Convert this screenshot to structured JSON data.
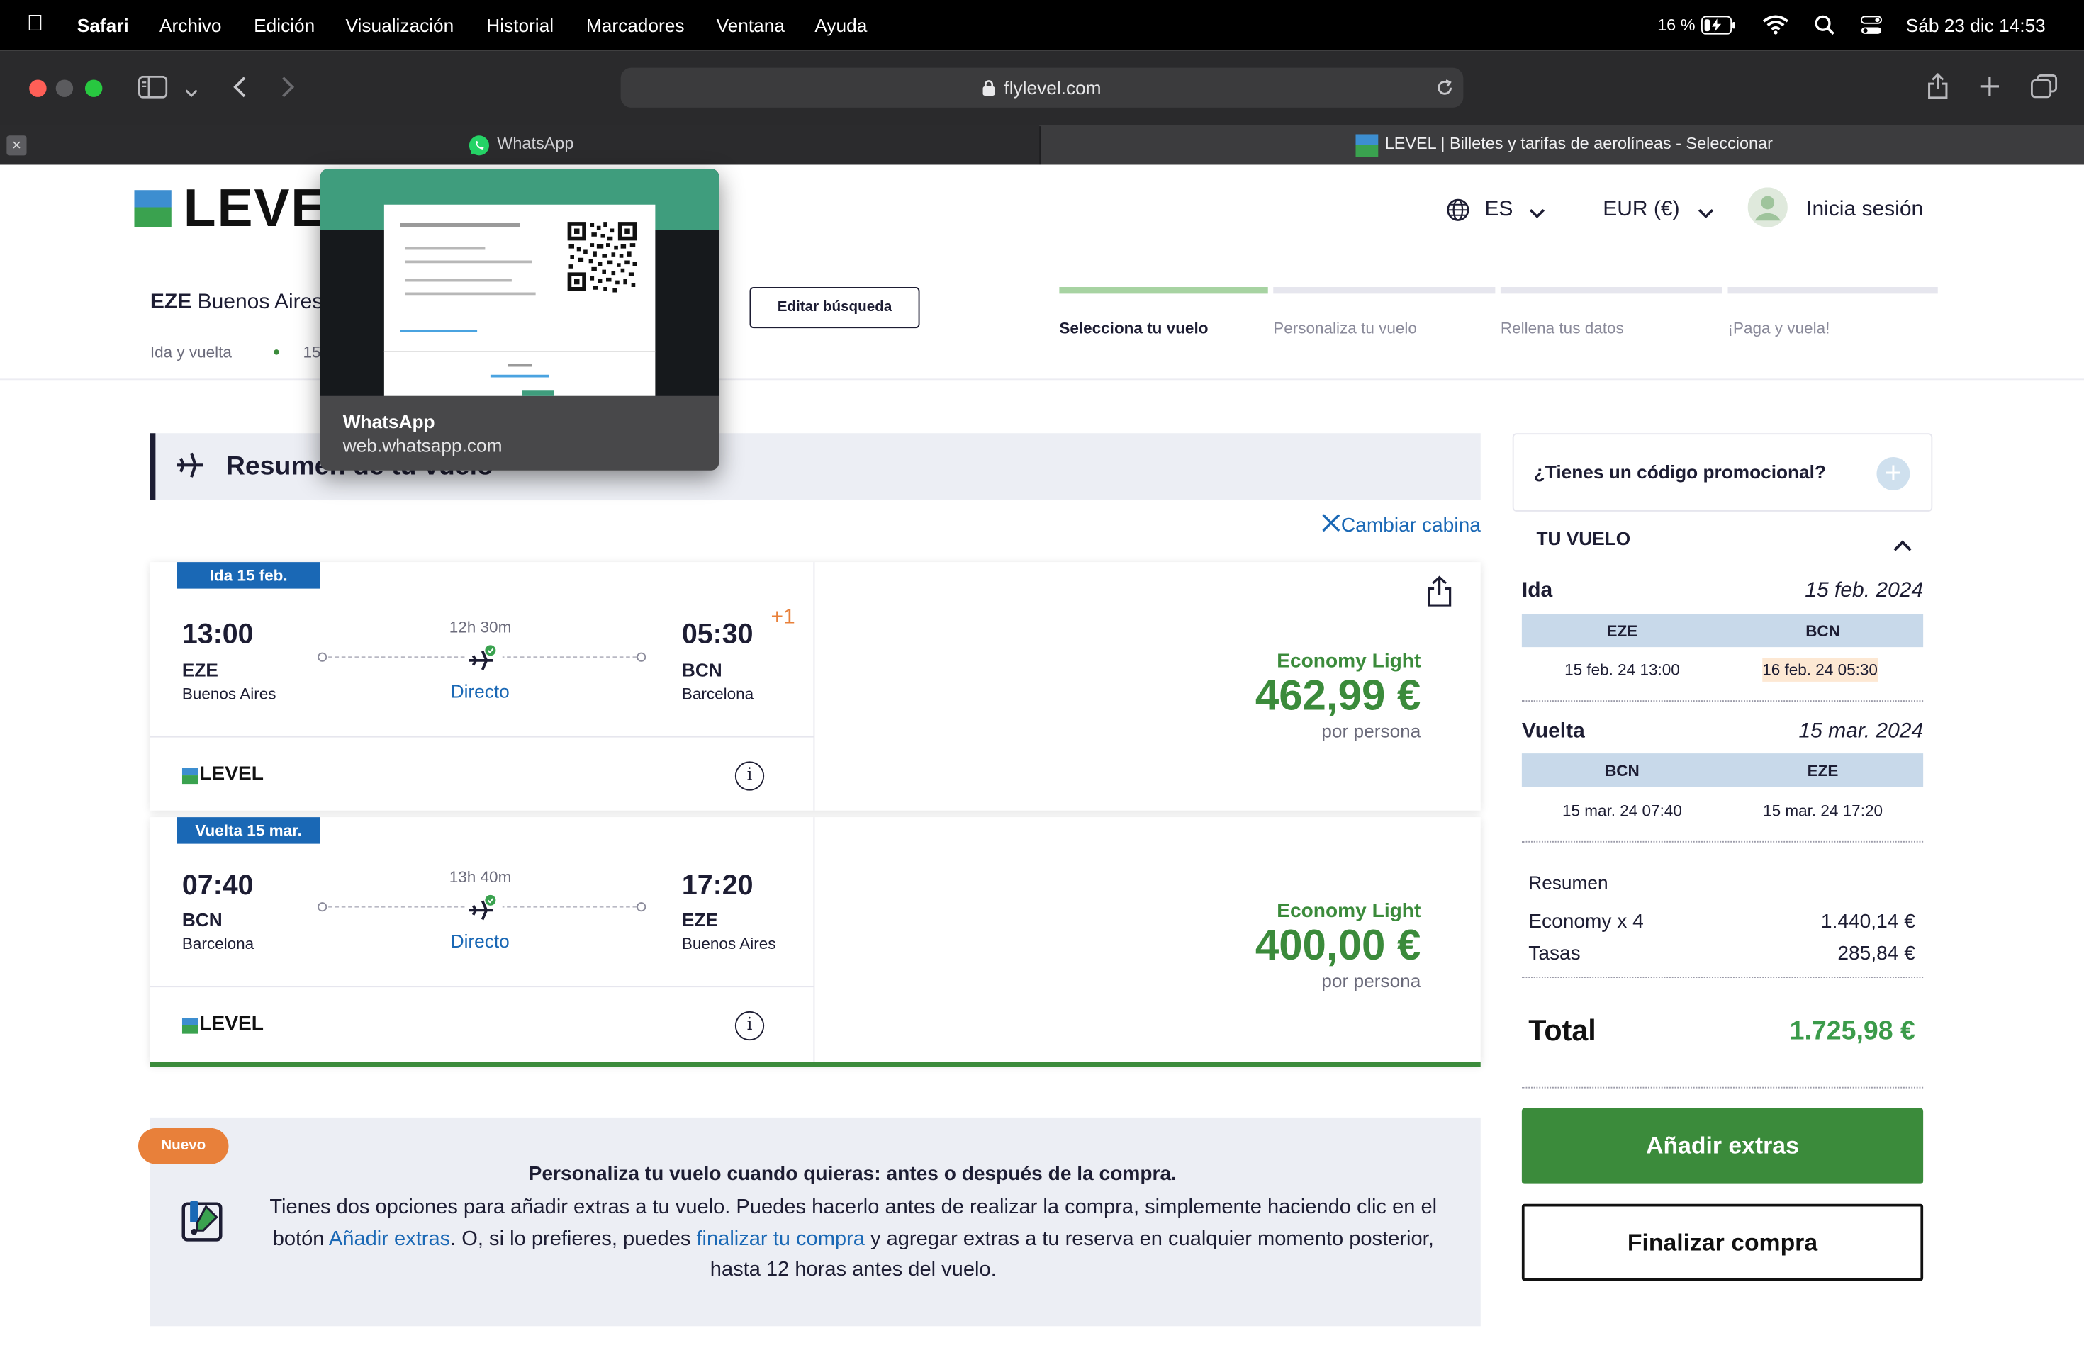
{
  "menubar": {
    "app": "Safari",
    "menus": [
      "Archivo",
      "Edición",
      "Visualización",
      "Historial",
      "Marcadores",
      "Ventana",
      "Ayuda"
    ],
    "battery": "16 %",
    "datetime": "Sáb 23 dic  14:53"
  },
  "browser": {
    "url": "flylevel.com",
    "tabs": [
      {
        "title": "WhatsApp"
      },
      {
        "title": "LEVEL | Billetes y tarifas de aerolíneas - Seleccionar"
      }
    ],
    "preview": {
      "title": "WhatsApp",
      "url": "web.whatsapp.com"
    }
  },
  "header": {
    "logo": "LEVEL",
    "language": "ES",
    "currency": "EUR (€)",
    "login": "Inicia sesión",
    "search_from": "EZE",
    "search_from_city": "Buenos Aires",
    "trip_type": "Ida y vuelta",
    "trip_date_short": "15",
    "edit_search": "Editar búsqueda",
    "steps": [
      "Selecciona tu vuelo",
      "Personaliza tu vuelo",
      "Rellena tus datos",
      "¡Paga y vuela!"
    ]
  },
  "summary": {
    "title": "Resumen de tu vuelo",
    "change_cabin": "Cambiar cabina"
  },
  "flights": [
    {
      "tag": "Ida 15 feb.",
      "dep_time": "13:00",
      "dep_code": "EZE",
      "dep_city": "Buenos Aires",
      "duration": "12h 30m",
      "stops": "Directo",
      "arr_time": "05:30",
      "arr_code": "BCN",
      "arr_city": "Barcelona",
      "next_day": "+1",
      "airline": "LEVEL",
      "fare": "Economy Light",
      "price": "462,99 €",
      "per": "por persona"
    },
    {
      "tag": "Vuelta 15 mar.",
      "dep_time": "07:40",
      "dep_code": "BCN",
      "dep_city": "Barcelona",
      "duration": "13h 40m",
      "stops": "Directo",
      "arr_time": "17:20",
      "arr_code": "EZE",
      "arr_city": "Buenos Aires",
      "next_day": "",
      "airline": "LEVEL",
      "fare": "Economy Light",
      "price": "400,00 €",
      "per": "por persona"
    }
  ],
  "extras": {
    "badge": "Nuevo",
    "title": "Personaliza tu vuelo cuando quieras: antes o después de la compra.",
    "body_1": "Tienes dos opciones para añadir extras a tu vuelo. Puedes hacerlo antes de realizar la compra, simplemente haciendo clic en el botón ",
    "link_1": "Añadir extras",
    "body_2": ". O, si lo prefieres, puedes ",
    "link_2": "finalizar tu compra",
    "body_3": " y agregar extras a tu reserva en cualquier momento posterior, hasta 12 horas antes del vuelo."
  },
  "sidebar": {
    "promo": "¿Tienes un código promocional?",
    "your_flight": "TU VUELO",
    "outbound": {
      "label": "Ida",
      "date": "15 feb. 2024",
      "from": "EZE",
      "to": "BCN",
      "dep": "15 feb. 24 13:00",
      "arr": "16 feb. 24 05:30"
    },
    "inbound": {
      "label": "Vuelta",
      "date": "15 mar. 2024",
      "from": "BCN",
      "to": "EZE",
      "dep": "15 mar. 24 07:40",
      "arr": "15 mar. 24 17:20"
    },
    "summary_label": "Resumen",
    "rows": [
      {
        "label": "Economy x 4",
        "value": "1.440,14 €"
      },
      {
        "label": "Tasas",
        "value": "285,84 €"
      }
    ],
    "total_label": "Total",
    "total_value": "1.725,98 €",
    "add_extras": "Añadir extras",
    "finish": "Finalizar compra"
  },
  "colors": {
    "brand_green": "#3b8b3b",
    "brand_blue": "#1a68b5",
    "accent_orange": "#e8803a",
    "navy": "#1d1d33"
  }
}
